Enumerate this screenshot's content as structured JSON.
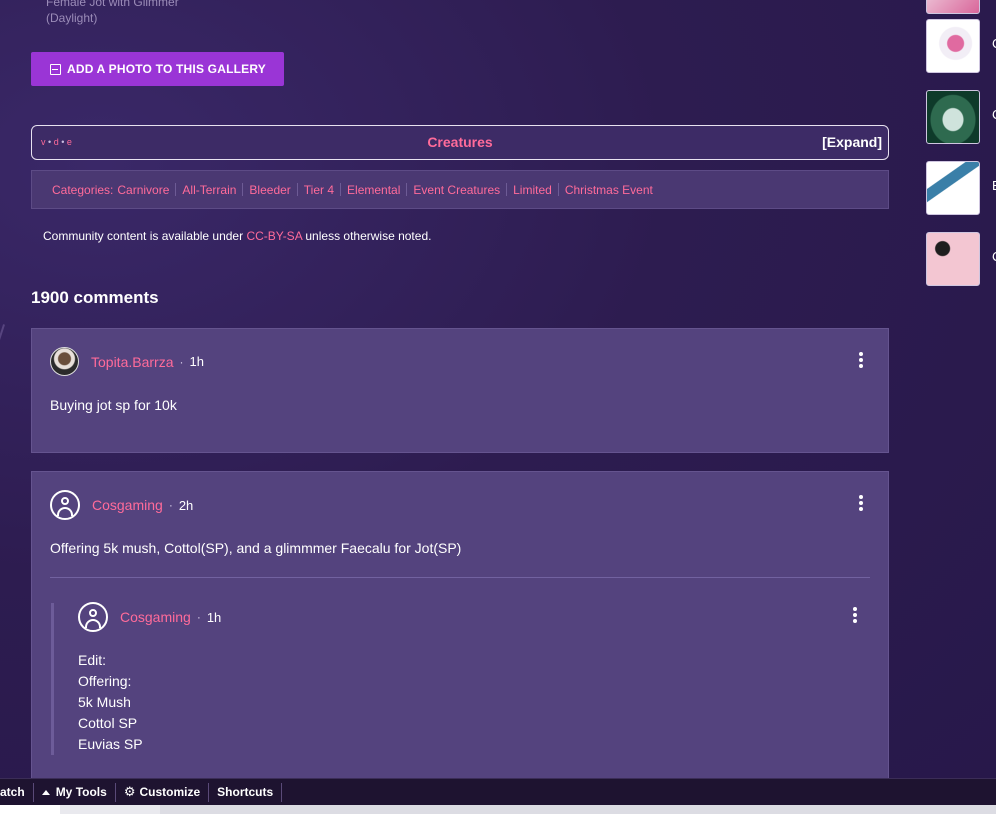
{
  "gallery": {
    "caption_line1": "Female Jot with Glimmer",
    "caption_line2": "(Daylight)",
    "add_photo_label": "ADD A PHOTO TO THIS GALLERY"
  },
  "navbox": {
    "vde_v": "v",
    "vde_d": "d",
    "vde_e": "e",
    "title": "Creatures",
    "expand_label": "[Expand]"
  },
  "categories": {
    "label": "Categories:",
    "items": [
      "Carnivore",
      "All-Terrain",
      "Bleeder",
      "Tier 4",
      "Elemental",
      "Event Creatures",
      "Limited",
      "Christmas Event"
    ]
  },
  "license": {
    "prefix": "Community content is available under",
    "link": "CC-BY-SA",
    "suffix": "unless otherwise noted."
  },
  "comments": {
    "count_label": "1900 comments",
    "items": [
      {
        "author": "Topita.Barrza",
        "time": "1h",
        "text": "Buying jot sp for 10k"
      },
      {
        "author": "Cosgaming",
        "time": "2h",
        "text": "Offering 5k mush, Cottol(SP), and a glimmmer Faecalu for Jot(SP)",
        "reply": {
          "author": "Cosgaming",
          "time": "1h",
          "lines": [
            "Edit:",
            "Offering:",
            "5k Mush",
            "Cottol SP",
            "Euvias SP"
          ]
        }
      }
    ]
  },
  "sidebar": {
    "labels": [
      "C",
      "C",
      "E",
      "C"
    ]
  },
  "toolbar": {
    "watch_label": "atch",
    "my_tools_label": "My Tools",
    "customize_label": "Customize",
    "shortcuts_label": "Shortcuts"
  },
  "colors": {
    "background": "#2e1d52",
    "accent_pink": "#ff6b9a",
    "button_purple": "#9a35d6",
    "card": "#54437e"
  }
}
